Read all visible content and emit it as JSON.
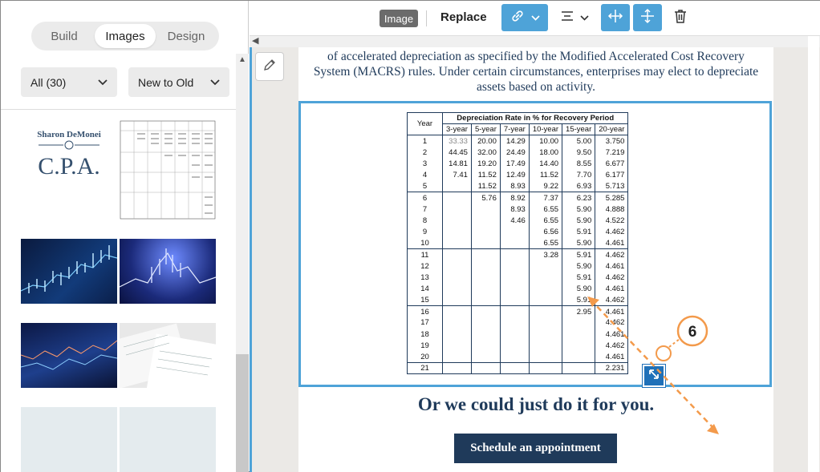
{
  "left_panel": {
    "tabs": [
      {
        "label": "Build",
        "active": false
      },
      {
        "label": "Images",
        "active": true
      },
      {
        "label": "Design",
        "active": false
      }
    ],
    "filter_all": "All (30)",
    "sort": "New to Old",
    "logo": {
      "line1": "Sharon DeMonei",
      "line2": "C.P.A."
    }
  },
  "toolbar": {
    "badge": "Image",
    "replace": "Replace"
  },
  "page": {
    "paragraph": "of accelerated depreciation as specified by the Modified Accelerated Cost Recovery System (MACRS) rules. Under certain circumstances, enterprises may elect to depreciate assets based on activity.",
    "heading": "Or we could just do it for you.",
    "cta": "Schedule an appointment"
  },
  "table": {
    "title": "Depreciation Rate in % for Recovery Period",
    "year_header": "Year",
    "columns": [
      "3-year",
      "5-year",
      "7-year",
      "10-year",
      "15-year",
      "20-year"
    ],
    "rows": [
      [
        "1",
        "33.33",
        "20.00",
        "14.29",
        "10.00",
        "5.00",
        "3.750"
      ],
      [
        "2",
        "44.45",
        "32.00",
        "24.49",
        "18.00",
        "9.50",
        "7.219"
      ],
      [
        "3",
        "14.81",
        "19.20",
        "17.49",
        "14.40",
        "8.55",
        "6.677"
      ],
      [
        "4",
        "7.41",
        "11.52",
        "12.49",
        "11.52",
        "7.70",
        "6.177"
      ],
      [
        "5",
        "",
        "11.52",
        "8.93",
        "9.22",
        "6.93",
        "5.713"
      ],
      [
        "6",
        "",
        "5.76",
        "8.92",
        "7.37",
        "6.23",
        "5.285"
      ],
      [
        "7",
        "",
        "",
        "8.93",
        "6.55",
        "5.90",
        "4.888"
      ],
      [
        "8",
        "",
        "",
        "4.46",
        "6.55",
        "5.90",
        "4.522"
      ],
      [
        "9",
        "",
        "",
        "",
        "6.56",
        "5.91",
        "4.462"
      ],
      [
        "10",
        "",
        "",
        "",
        "6.55",
        "5.90",
        "4.461"
      ],
      [
        "11",
        "",
        "",
        "",
        "3.28",
        "5.91",
        "4.462"
      ],
      [
        "12",
        "",
        "",
        "",
        "",
        "5.90",
        "4.461"
      ],
      [
        "13",
        "",
        "",
        "",
        "",
        "5.91",
        "4.462"
      ],
      [
        "14",
        "",
        "",
        "",
        "",
        "5.90",
        "4.461"
      ],
      [
        "15",
        "",
        "",
        "",
        "",
        "5.91",
        "4.462"
      ],
      [
        "16",
        "",
        "",
        "",
        "",
        "2.95",
        "4.461"
      ],
      [
        "17",
        "",
        "",
        "",
        "",
        "",
        "4.462"
      ],
      [
        "18",
        "",
        "",
        "",
        "",
        "",
        "4.461"
      ],
      [
        "19",
        "",
        "",
        "",
        "",
        "",
        "4.462"
      ],
      [
        "20",
        "",
        "",
        "",
        "",
        "",
        "4.461"
      ],
      [
        "21",
        "",
        "",
        "",
        "",
        "",
        "2.231"
      ]
    ]
  },
  "annotation": {
    "step": "6"
  },
  "colors": {
    "accent": "#4ea3d8",
    "navy": "#1f3a5a",
    "annotation": "#f39a4b"
  }
}
